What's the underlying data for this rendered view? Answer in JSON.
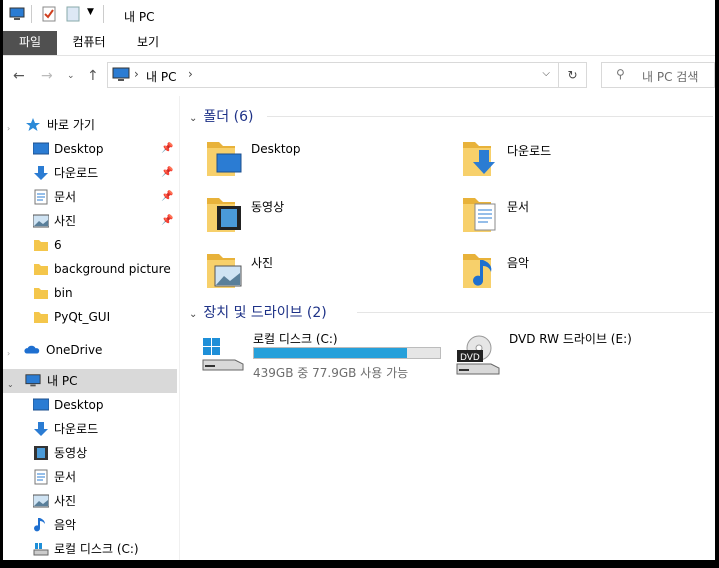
{
  "title": "내 PC",
  "ribbon": {
    "tabs": [
      "파일",
      "컴퓨터",
      "보기"
    ]
  },
  "address": {
    "path": "내 PC",
    "sep": "›"
  },
  "search": {
    "placeholder": "내 PC 검색"
  },
  "nav": {
    "quick_access": "바로 가기",
    "quick_items": [
      "Desktop",
      "다운로드",
      "문서",
      "사진",
      "6",
      "background picture",
      "bin",
      "PyQt_GUI"
    ],
    "onedrive": "OneDrive",
    "this_pc": "내 PC",
    "pc_items": [
      "Desktop",
      "다운로드",
      "동영상",
      "문서",
      "사진",
      "음악",
      "로컬 디스크 (C:)"
    ]
  },
  "folders": {
    "header": "폴더 (6)",
    "items": [
      "Desktop",
      "다운로드",
      "동영상",
      "문서",
      "사진",
      "음악"
    ]
  },
  "devices": {
    "header": "장치 및 드라이브 (2)",
    "c_name": "로컬 디스크 (C:)",
    "c_free": "439GB 중 77.9GB 사용 가능",
    "c_used_fraction": 0.82,
    "dvd_name": "DVD RW 드라이브 (E:)",
    "dvd_label": "DVD"
  },
  "colors": {
    "accent": "#26a0da",
    "group_header": "#1e3287",
    "folder": "#f4c64b"
  }
}
